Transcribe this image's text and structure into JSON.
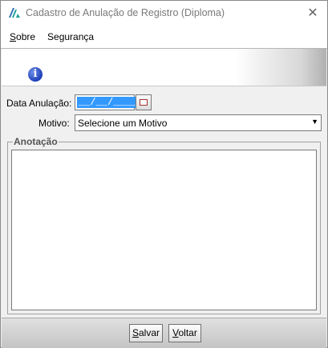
{
  "window": {
    "title": "Cadastro de Anulação de Registro (Diploma)",
    "close_glyph": "✕"
  },
  "menu": {
    "items": [
      {
        "accel": "S",
        "rest": "obre"
      },
      {
        "accel": "S",
        "rest": "egurança"
      }
    ]
  },
  "banner": {
    "icon": "info-icon",
    "glyph": "i"
  },
  "form": {
    "date_label": "Data Anulação:",
    "date_value": "__/__/____",
    "reason_label": "Motivo:",
    "reason_value": "Selecione um Motivo",
    "reason_arrow": "▼",
    "notes_legend": "Anotação",
    "notes_value": ""
  },
  "footer": {
    "save": {
      "accel": "S",
      "rest": "alvar"
    },
    "back": {
      "accel": "V",
      "rest": "oltar"
    }
  },
  "colors": {
    "selection": "#3399ff",
    "info_icon": "#1d3fb8"
  }
}
